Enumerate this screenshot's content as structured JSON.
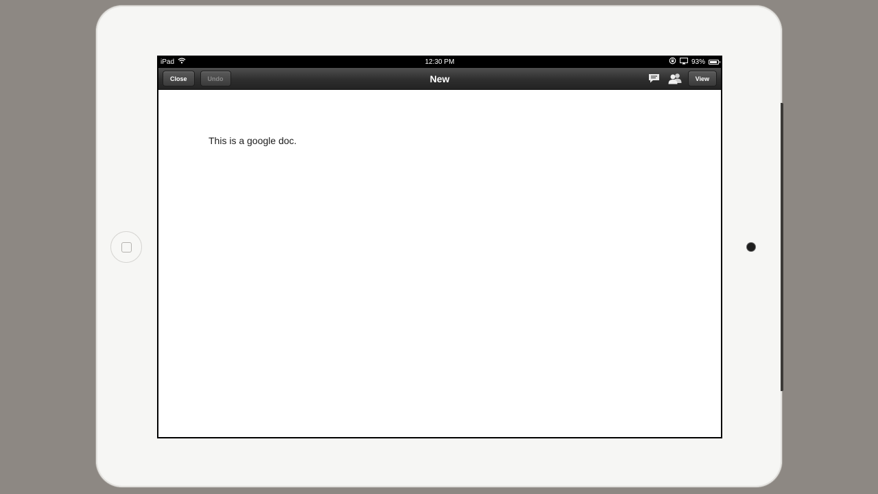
{
  "status_bar": {
    "device_name": "iPad",
    "time": "12:30 PM",
    "battery_percent": "93%",
    "battery_level": 0.93
  },
  "toolbar": {
    "close_label": "Close",
    "undo_label": "Undo",
    "title": "New",
    "view_label": "View",
    "icons": [
      "comments-icon",
      "share-people-icon"
    ]
  },
  "document": {
    "text": "This is a google doc."
  },
  "colors": {
    "toolbar_dark": "#2e2e2e",
    "bezel": "#f6f6f4",
    "backdrop": "#8d8883"
  }
}
